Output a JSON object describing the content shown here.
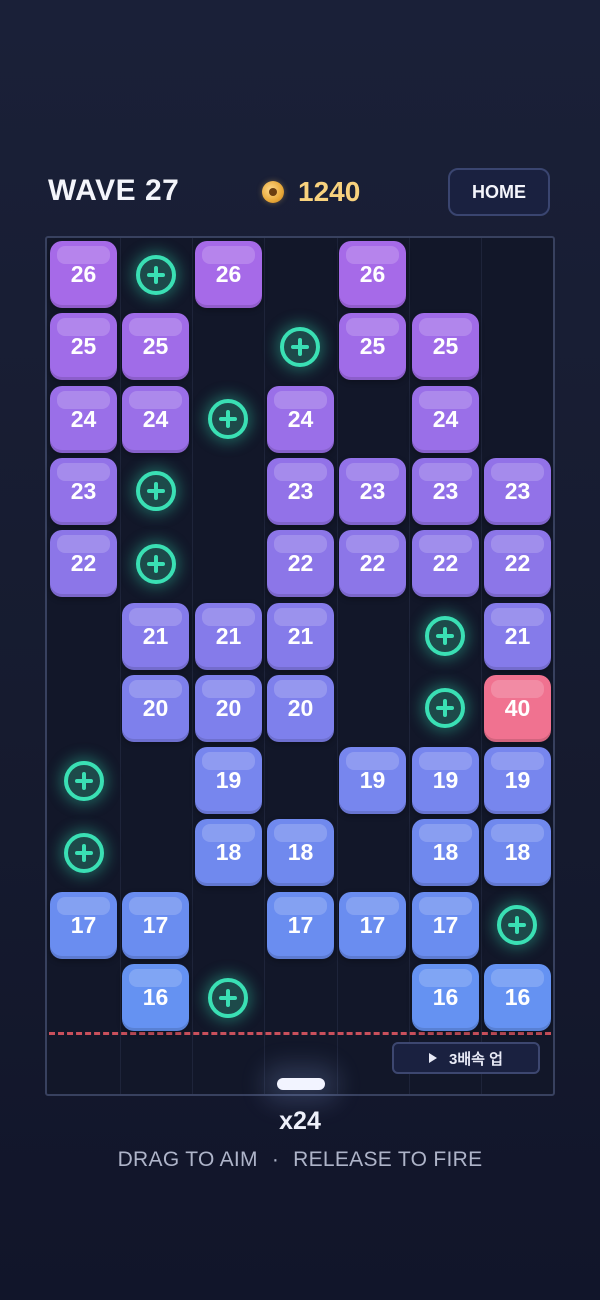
{
  "hud": {
    "wave_label": "WAVE 27",
    "coins": "1240",
    "home_label": "HOME"
  },
  "board": {
    "columns": 7,
    "rows": [
      [
        "26",
        "+",
        "26",
        null,
        "26",
        null,
        null
      ],
      [
        "25",
        "25",
        null,
        "+",
        "25",
        "25",
        null
      ],
      [
        "24",
        "24",
        "+",
        "24",
        null,
        "24",
        null
      ],
      [
        "23",
        "+",
        null,
        "23",
        "23",
        "23",
        "23"
      ],
      [
        "22",
        "+",
        null,
        "22",
        "22",
        "22",
        "22"
      ],
      [
        null,
        "21",
        "21",
        "21",
        null,
        "+",
        "21"
      ],
      [
        null,
        "20",
        "20",
        "20",
        null,
        "+",
        "40"
      ],
      [
        "+",
        null,
        "19",
        null,
        "19",
        "19",
        "19"
      ],
      [
        "+",
        null,
        "18",
        "18",
        null,
        "18",
        "18"
      ],
      [
        "17",
        "17",
        null,
        "17",
        "17",
        "17",
        "+"
      ],
      [
        null,
        "16",
        "+",
        null,
        null,
        "16",
        "16"
      ]
    ],
    "row_colors": [
      "#a66ae8",
      "#a06ce8",
      "#9a6fe8",
      "#9272e8",
      "#8c76e8",
      "#857bea",
      "#7e80ec",
      "#7786ee",
      "#7089ee",
      "#6a8df0",
      "#6592f2"
    ],
    "special_color": "#f07290",
    "plus_color": "#3ae0b4",
    "danger_color": "#c9505c"
  },
  "controls": {
    "speed_label": "3배속 업",
    "ball_count": "x24",
    "hint_left": "DRAG TO AIM",
    "hint_sep": "·",
    "hint_right": "RELEASE TO FIRE"
  }
}
